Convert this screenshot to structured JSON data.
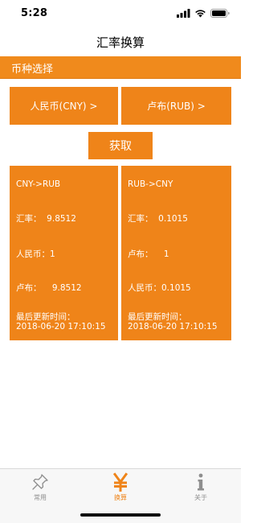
{
  "status_bar": {
    "time": "5:28",
    "signal_icon": "cellular-signal-icon",
    "wifi_icon": "wifi-icon",
    "battery_icon": "battery-icon"
  },
  "nav": {
    "title": "汇率换算"
  },
  "section": {
    "title": "币种选择"
  },
  "currency_select": {
    "left_label": "人民币(CNY) >",
    "right_label": "卢布(RUB) >"
  },
  "fetch_button": {
    "label": "获取"
  },
  "cards": {
    "left": {
      "direction": "CNY->RUB",
      "rate_line": "汇率：  9.8512",
      "base_line": "人民币：1",
      "target_line": "卢布：    9.8512",
      "updated_label": "最后更新时间：",
      "updated_time": "2018-06-20 17:10:15"
    },
    "right": {
      "direction": "RUB->CNY",
      "rate_line": "汇率：  0.1015",
      "base_line": "卢布：    1",
      "target_line": "人民币：0.1015",
      "updated_label": "最后更新时间：",
      "updated_time": "2018-06-20 17:10:15"
    }
  },
  "tab_bar": {
    "tabs": [
      {
        "label": "常用",
        "icon": "pushpin-icon",
        "active": false
      },
      {
        "label": "换算",
        "icon": "yen-icon",
        "active": true
      },
      {
        "label": "关于",
        "icon": "info-icon",
        "active": false
      }
    ]
  },
  "colors": {
    "accent": "#ef8419",
    "tab_inactive": "#8e8e8e"
  }
}
